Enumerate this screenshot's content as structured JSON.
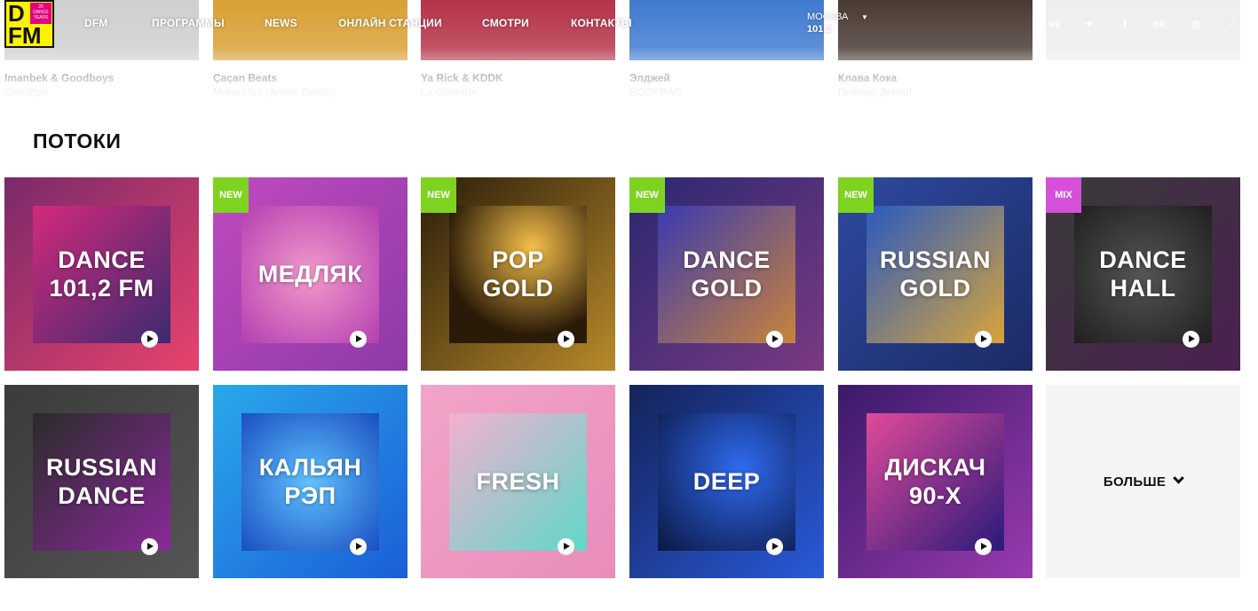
{
  "logo": {
    "top": "D",
    "bottom": "FM",
    "badge": "20 DANCE YEARS"
  },
  "nav": {
    "items": [
      "DFM",
      "ПРОГРАММЫ",
      "NEWS",
      "ОНЛАЙН СТАНЦИИ",
      "СМОТРИ",
      "КОНТАКТЫ"
    ],
    "city": "МОСКВА",
    "frequency": "101.2"
  },
  "social": [
    "vk-icon",
    "twitter-icon",
    "facebook-icon",
    "odnoklassniki-icon",
    "instagram-icon",
    "tiktok-icon"
  ],
  "social_glyphs": [
    "vk",
    "✦",
    "f",
    "ok",
    "◎",
    "♪"
  ],
  "recent_tracks": [
    {
      "artist": "Imanbek & Goodboys",
      "title": "Goodbye",
      "color": "#cfcfcf"
    },
    {
      "artist": "Çaçan Beats",
      "title": "Mona Lisa (Amice Remix)",
      "color": "#d9a035"
    },
    {
      "artist": "Ya Rick & KDDK",
      "title": "La Grenade",
      "color": "#b63348"
    },
    {
      "artist": "Элджей",
      "title": "BODYBAG",
      "color": "#3f7bd0"
    },
    {
      "artist": "Клава Кока",
      "title": "Пьяную Домой",
      "color": "#4a3a33"
    },
    {
      "artist": "",
      "title": "",
      "color": "#eeeeee"
    }
  ],
  "section_title": "ПОТОКИ",
  "streams": [
    {
      "label": "DANCE\n101,2 FM",
      "badge": "",
      "bg": "linear-gradient(135deg,#7a2a6a,#e8436c)",
      "inner": "linear-gradient(135deg,#d32a7b,#3c2a70)",
      "badge_color": ""
    },
    {
      "label": "МЕДЛЯК",
      "badge": "NEW",
      "bg": "linear-gradient(135deg,#c04ac0,#8e3aa8)",
      "inner": "radial-gradient(circle,#f39acb,#b33fb0)",
      "badge_color": "#7ed321"
    },
    {
      "label": "POP\nGOLD",
      "badge": "NEW",
      "bg": "linear-gradient(135deg,#2a1d0a,#b88a2a)",
      "inner": "radial-gradient(circle at 60% 30%,#f5c04a,#2a1a08 70%)",
      "badge_color": "#7ed321"
    },
    {
      "label": "DANCE\nGOLD",
      "badge": "NEW",
      "bg": "linear-gradient(135deg,#2a2870,#7a3a82)",
      "inner": "linear-gradient(135deg,#3a3ab0,#c9843a)",
      "badge_color": "#7ed321"
    },
    {
      "label": "RUSSIAN\nGOLD",
      "badge": "NEW",
      "bg": "linear-gradient(135deg,#2e4aa0,#1c2a66)",
      "inner": "linear-gradient(135deg,#2a5ac0,#d8a43a)",
      "badge_color": "#7ed321"
    },
    {
      "label": "DANCE\nHALL",
      "badge": "MIX",
      "bg": "linear-gradient(135deg,#3a3a3a,#4a2050)",
      "inner": "radial-gradient(circle,#555,#1f1f1f)",
      "badge_color": "#d54fd8"
    },
    {
      "label": "RUSSIAN\nDANCE",
      "badge": "",
      "bg": "linear-gradient(135deg,#3b3b3b,#555)",
      "inner": "linear-gradient(135deg,#2b2b2b,#8a2a9a)",
      "badge_color": ""
    },
    {
      "label": "КАЛЬЯН\nРЭП",
      "badge": "",
      "bg": "linear-gradient(135deg,#2aa8ea,#1b5ed8)",
      "inner": "radial-gradient(circle,#5fc2ff,#1a4ec0)",
      "badge_color": ""
    },
    {
      "label": "FRESH",
      "badge": "",
      "bg": "linear-gradient(135deg,#f2a4c8,#e98cba)",
      "inner": "linear-gradient(135deg,#f4b0d0,#5fd8c8)",
      "badge_color": ""
    },
    {
      "label": "DEEP",
      "badge": "",
      "bg": "linear-gradient(135deg,#14235a,#2a5ad8)",
      "inner": "radial-gradient(circle at 60% 40%,#2e6af0,#0c1640)",
      "badge_color": ""
    },
    {
      "label": "ДИСКАЧ\n90-Х",
      "badge": "",
      "bg": "linear-gradient(135deg,#3a1a6a,#9a3ab0)",
      "inner": "linear-gradient(135deg,#e04a9a,#2a1a7a)",
      "badge_color": ""
    }
  ],
  "more_label": "БОЛЬШЕ"
}
